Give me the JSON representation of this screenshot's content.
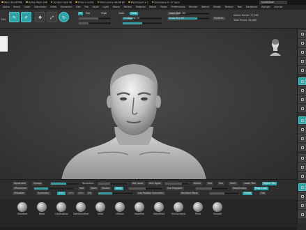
{
  "infobar": {
    "items": [
      "Mem 39,687MB",
      "Active Mem 496",
      "Scratch Disk 48",
      "Timer ▸ 0.001",
      "PolyCount ▸ 48.68 KP",
      "MeshCount ▸ 2",
      "QuickSave In 37 Secs"
    ],
    "quicksave": "QuickSave",
    "right_field": "QuickSave"
  },
  "menu": [
    "Alpha",
    "Brush",
    "Color",
    "Document",
    "Draw",
    "Dynamics",
    "Edit",
    "File",
    "Layer",
    "Light",
    "Macro",
    "Marker",
    "Material",
    "Movie",
    "Picker",
    "Preferences",
    "Render",
    "Stencil",
    "Stroke",
    "Texture",
    "Tool",
    "Transform",
    "Zplugin",
    "Zscript"
  ],
  "toolbar": {
    "edit_label": "Edit",
    "draw_label": "Draw",
    "move_label": "Move",
    "scale_label": "Scale",
    "rotate_label": "Rotate",
    "mrgb": "Mrgb",
    "rgb": "Rgb",
    "m": "M",
    "zadd": "Zadd",
    "zsub": "Zsub",
    "rgb_intensity_label": "Rgb Intensity",
    "rgb_intensity_value": "100",
    "z_intensity_label": "Z Intensity",
    "z_intensity_value": "25",
    "focal_label": "Focal Shift",
    "focal_value": "-84",
    "draw_size_label": "Draw Size",
    "draw_size_value": "64",
    "active_points": "Active Points: 17,389",
    "total_points": "Total Points: 48,680",
    "dynamic": "Dynamic",
    "zbrush_val": "0.023",
    "dual_num": "2.41",
    "dual_text": "Dynamesh"
  },
  "bottom": {
    "row1": {
      "a": "Dynamesh",
      "b": "Groups",
      "c": "Polish",
      "d": "Blur",
      "e": "Project",
      "f": "Resolution",
      "g": "SubProjection",
      "h": "Sdiv",
      "i": "Del Lower",
      "j": "Del Higher",
      "k": "Freeze SubDiv Levels",
      "l": "Reproject Higher Subdiv",
      "m": "Divide",
      "n": "Smt",
      "o": "Suv",
      "p": "ReUV",
      "q": "Lower Res",
      "r": "Higher Res"
    },
    "row2": {
      "a": "ZRemesher",
      "b": "Target Polygons Count 5",
      "c": "Half",
      "d": "Same",
      "e": "Double",
      "f": "Adapt",
      "g": "AdaptiveSize 50",
      "h": "Use Polypaint",
      "i": "Curves Strength 50",
      "j": "KeepGroups",
      "k": "Edge Loop",
      "l": "Panel Loops",
      "m": "Group Loops",
      "n": "Crease",
      "o": "UnCrease",
      "p": "Keep UV",
      "q": "Crease PG"
    },
    "row3": {
      "a": "ZModeler",
      "b": "Symmetry",
      "c": ">X<",
      "d": ">Y<",
      "e": ">Z<",
      "f": "(M)",
      "g": "Radial Count 8",
      "h": "Use Posable Symmetry",
      "i": "Activate Symmetry",
      "j": "Poseable",
      "k": "Backface Mask",
      "l": "BackTrans 0.5",
      "m": "Mask By Polygroups 0",
      "n": "Frame",
      "o": "Flat"
    }
  },
  "brushes": [
    {
      "name": "Standard",
      "icon": "standard-brush-icon"
    },
    {
      "name": "Move",
      "icon": "move-brush-icon"
    },
    {
      "name": "ClayBuildup",
      "icon": "claybuildup-brush-icon"
    },
    {
      "name": "DamStandard",
      "icon": "damstandard-brush-icon"
    },
    {
      "name": "Inflat",
      "icon": "inflat-brush-icon"
    },
    {
      "name": "hPolish",
      "icon": "hpolish-brush-icon"
    },
    {
      "name": "MaskPen",
      "icon": "maskpen-brush-icon"
    },
    {
      "name": "SelectRect",
      "icon": "selectrect-brush-icon"
    },
    {
      "name": "TrimDynamic",
      "icon": "trimdynamic-brush-icon"
    },
    {
      "name": "Pinch",
      "icon": "pinch-brush-icon"
    },
    {
      "name": "Smooth",
      "icon": "smooth-brush-icon"
    }
  ],
  "colors": {
    "accent": "#2fa3a7",
    "bg": "#2b2b2b",
    "canvas": "#3c3c3c"
  }
}
